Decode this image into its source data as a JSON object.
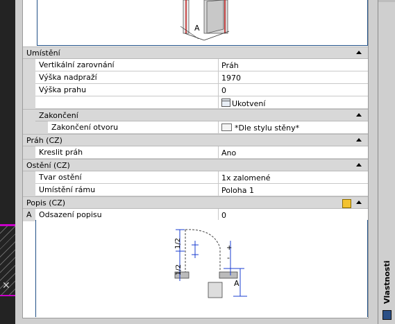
{
  "palette_title": "Vlastnosti",
  "sections": {
    "umisteni": {
      "title": "Umístění",
      "rows": [
        {
          "name": "Vertikální zarovnání",
          "value": "Práh"
        },
        {
          "name": "Výška nadpraží",
          "value": "1970"
        },
        {
          "name": "Výška prahu",
          "value": "0"
        },
        {
          "name": "",
          "value": "Ukotvení"
        }
      ],
      "subcat_title": "Zakončení",
      "sub_rows": [
        {
          "name": "Zakončení otvoru",
          "value": "*Dle stylu stěny*"
        }
      ]
    },
    "prah": {
      "title": "Práh (CZ)",
      "rows": [
        {
          "name": "Kreslit práh",
          "value": "Ano"
        }
      ]
    },
    "osteni": {
      "title": "Ostění (CZ)",
      "rows": [
        {
          "name": "Tvar ostění",
          "value": "1x zalomené"
        },
        {
          "name": "Umístění rámu",
          "value": "Poloha 1"
        }
      ]
    },
    "popis": {
      "title": "Popis (CZ)",
      "marker": "A",
      "rows": [
        {
          "name": "Odsazení popisu",
          "value": "0"
        }
      ]
    }
  },
  "diagram_labels": {
    "top_dim": "A",
    "half1": "1/2",
    "half2": "1/2",
    "plus": "+",
    "minus": "-",
    "side_dim": "A"
  },
  "colors": {
    "drawing_accent": "#c800c8",
    "dimension_blue": "#1a3cd0",
    "frame_blue": "#1f4f86"
  }
}
